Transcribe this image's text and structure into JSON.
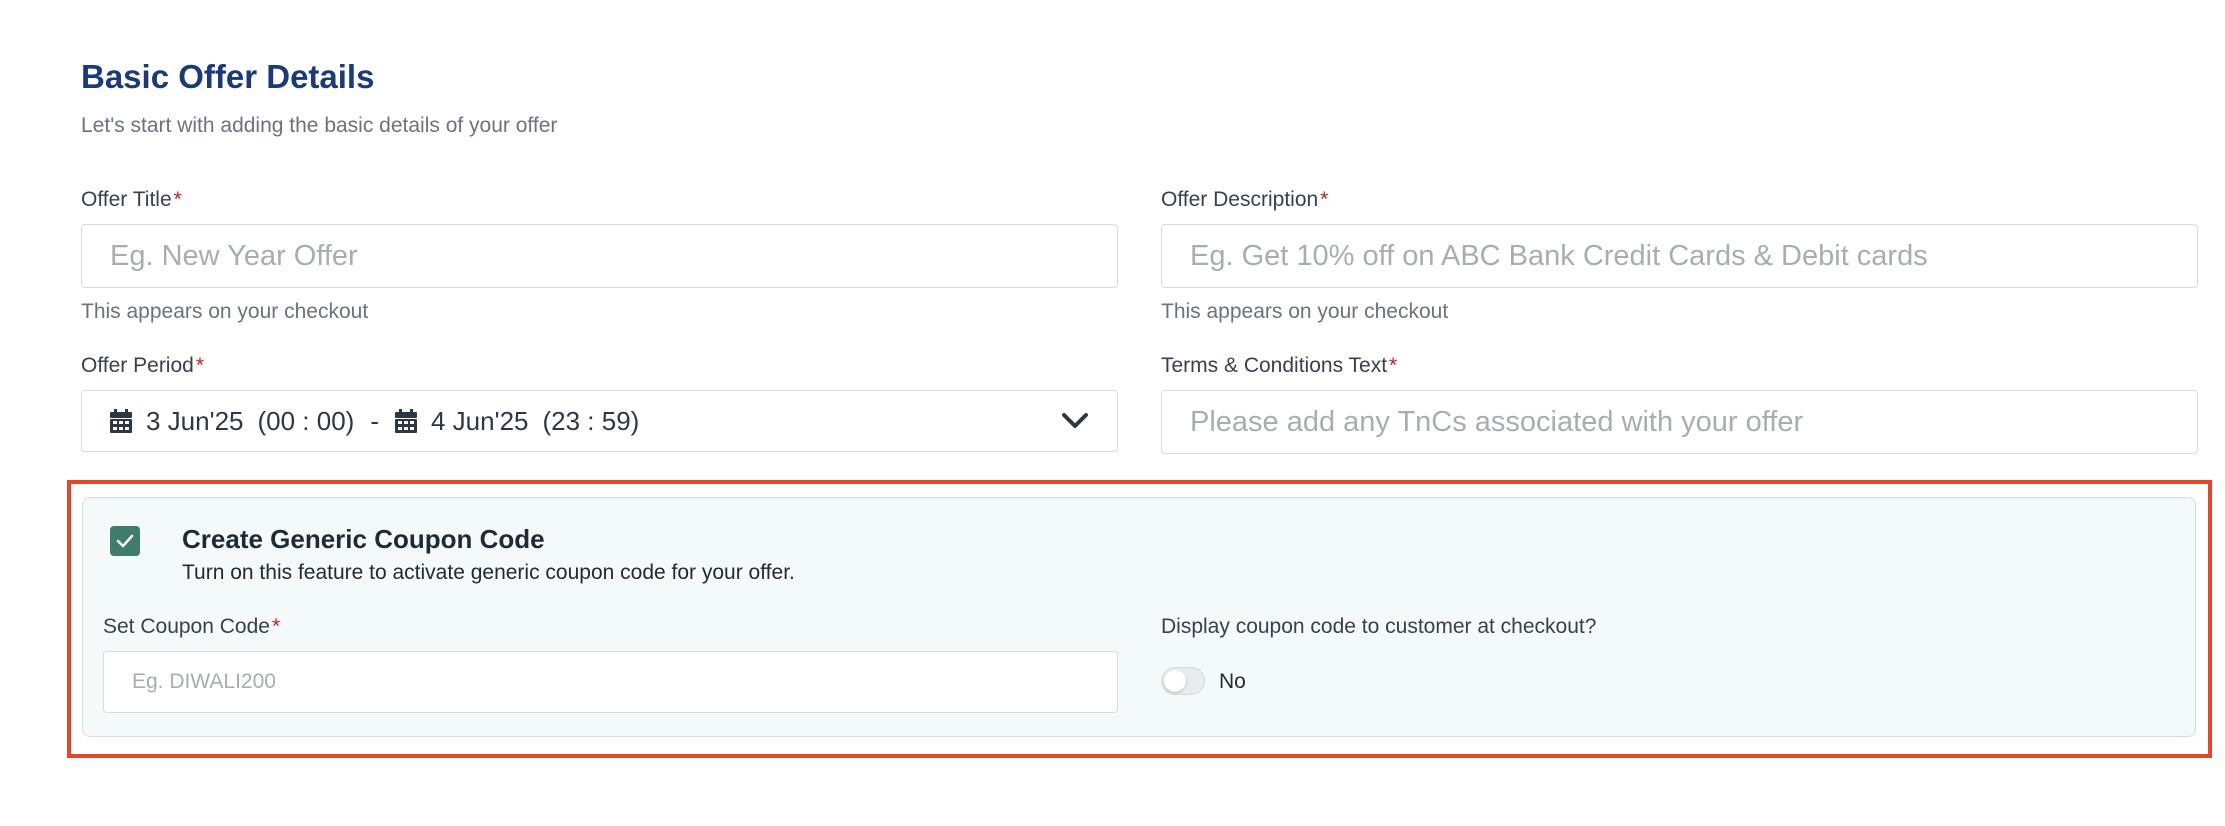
{
  "section": {
    "title": "Basic Offer Details",
    "subtitle": "Let's start with adding the basic details of your offer"
  },
  "offer_title": {
    "label": "Offer Title",
    "required": "*",
    "placeholder": "Eg. New Year Offer",
    "value": "",
    "helper": "This appears on your checkout"
  },
  "offer_description": {
    "label": "Offer Description",
    "required": "*",
    "placeholder": "Eg. Get 10% off on ABC Bank Credit Cards & Debit cards",
    "value": "",
    "helper": "This appears on your checkout"
  },
  "offer_period": {
    "label": "Offer Period",
    "required": "*",
    "start_date": "3 Jun'25",
    "start_time": "(00 : 00)",
    "separator": "-",
    "end_date": "4 Jun'25",
    "end_time": "(23 : 59)"
  },
  "terms": {
    "label": "Terms & Conditions Text",
    "required": "*",
    "placeholder": "Please add any TnCs associated with your offer",
    "value": ""
  },
  "coupon": {
    "checked": true,
    "title": "Create Generic Coupon Code",
    "description": "Turn on this feature to activate generic coupon code for your offer.",
    "code_label": "Set Coupon Code",
    "code_required": "*",
    "code_placeholder": "Eg. DIWALI200",
    "code_value": "",
    "display_label": "Display coupon code to customer at checkout?",
    "display_toggle_on": false,
    "display_toggle_text": "No"
  },
  "colors": {
    "title": "#1a3a7a",
    "required": "#c81e1e",
    "checkbox": "#3d7d6a",
    "highlight": "#e2462c",
    "panel_bg": "#f4f9f9"
  }
}
